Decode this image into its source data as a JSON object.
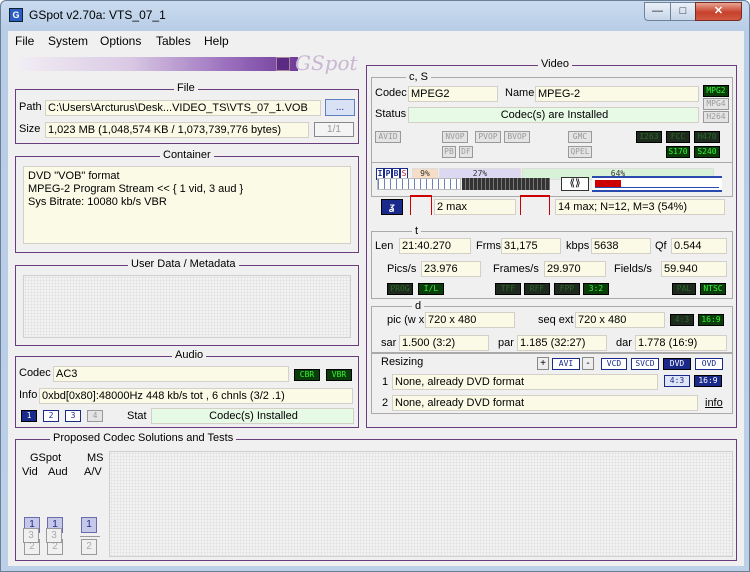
{
  "window": {
    "title": "GSpot v2.70a: VTS_07_1",
    "icon_letter": "G",
    "min": "—",
    "max": "□",
    "close": "✕"
  },
  "menu": [
    "File",
    "System",
    "Options",
    "Tables",
    "Help"
  ],
  "logo": {
    "text": "GSpot"
  },
  "file": {
    "title": "File",
    "path_label": "Path",
    "path": "C:\\Users\\Arcturus\\Desk...VIDEO_TS\\VTS_07_1.VOB",
    "browse": "...",
    "size_label": "Size",
    "size": "1,023 MB (1,048,574 KB / 1,073,739,776 bytes)",
    "page": "1/1"
  },
  "container": {
    "title": "Container",
    "lines": [
      "DVD \"VOB\" format",
      "MPEG-2 Program Stream << { 1 vid, 3 aud }",
      "Sys Bitrate: 10080 kb/s VBR"
    ]
  },
  "userdata": {
    "title": "User Data / Metadata"
  },
  "audio": {
    "title": "Audio",
    "codec_label": "Codec",
    "codec": "AC3",
    "cbr": "CBR",
    "vbr": "VBR",
    "info_label": "Info",
    "info": "0xbd[0x80]:48000Hz  448 kb/s tot , 6 chnls (3/2 .1)",
    "streams": [
      "1",
      "2",
      "3",
      "4"
    ],
    "stat_label": "Stat",
    "stat": "Codec(s) Installed"
  },
  "proposed": {
    "title": "Proposed Codec Solutions and Tests",
    "gspot": "GSpot",
    "vid": "Vid",
    "aud": "Aud",
    "ms": "MS",
    "av": "A/V",
    "n1": "1",
    "n2": "2",
    "n3": "3"
  },
  "video": {
    "title": "Video",
    "cs": {
      "title": "c, S",
      "codec_label": "Codec",
      "codec": "MPEG2",
      "name_label": "Name",
      "name": "MPEG-2",
      "status_label": "Status",
      "status": "Codec(s) are Installed",
      "fmt_tags": [
        "MPG2",
        "MPG4",
        "H264"
      ],
      "flags": [
        "AVID",
        "NVOP",
        "PVOP",
        "BVOP",
        "GMC",
        "I263",
        "FCC",
        "H470",
        "PB",
        "DF",
        "QPEL",
        "S170",
        "S240"
      ]
    },
    "gop": {
      "ipbs": [
        "I",
        "P",
        "B",
        "S"
      ],
      "pct_i": "9%",
      "pct_p": "27%",
      "pct_b": "64%",
      "max_left": "2 max",
      "max_right": "14 max; N=12, M=3 (54%)",
      "glyph": "⟪⟫"
    },
    "t": {
      "title": "t",
      "len_label": "Len",
      "len": "21:40.270",
      "frms_label": "Frms",
      "frms": "31,175",
      "kbps_label": "kbps",
      "kbps": "5638",
      "qf_label": "Qf",
      "qf": "0.544",
      "pics_label": "Pics/s",
      "pics": "23.976",
      "frames_label": "Frames/s",
      "frames": "29.970",
      "fields_label": "Fields/s",
      "fields": "59.940",
      "tags": [
        "PROG",
        "I/L",
        "TFF",
        "RFF",
        "FPP",
        "3:2",
        "PAL",
        "NTSC"
      ]
    },
    "d": {
      "title": "d",
      "pic_label": "pic (w x",
      "pic": "720 x 480",
      "seq_label": "seq ext",
      "seq": "720 x 480",
      "r43": "4:3",
      "r169": "16:9",
      "sar_label": "sar",
      "sar": "1.500 (3:2)",
      "par_label": "par",
      "par": "1.185 (32:27)",
      "dar_label": "dar",
      "dar": "1.778 (16:9)"
    },
    "resizing": {
      "label": "Resizing",
      "plus": "+",
      "avi": "AVI",
      "minus": "-",
      "vcd": "VCD",
      "svcd": "SVCD",
      "dvd": "DVD",
      "ovd": "OVD",
      "one": "1",
      "two": "2",
      "r1": "None, already DVD format",
      "r2": "None, already DVD format",
      "b43": "4:3",
      "b169": "16:9",
      "info": "info"
    }
  },
  "colors": {
    "accent": "#6a3e7e",
    "field": "#fafae6",
    "status_green": "#e6fae6",
    "lcd_on": "#35f535"
  }
}
